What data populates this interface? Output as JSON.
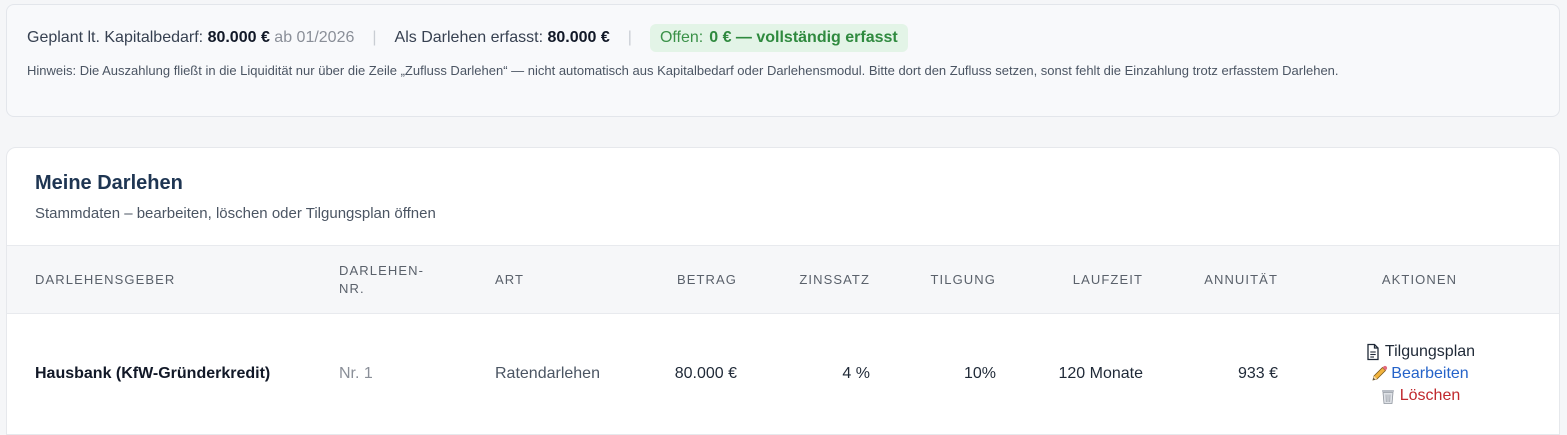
{
  "summary": {
    "planned_label": "Geplant lt. Kapitalbedarf:",
    "planned_value": "80.000 €",
    "planned_since": "ab 01/2026",
    "separator": "|",
    "loans_label": "Als Darlehen erfasst:",
    "loans_value": "80.000 €",
    "open_label": "Offen:",
    "open_value": "0 € — vollständig erfasst",
    "hint": "Hinweis: Die Auszahlung fließt in die Liquidität nur über die Zeile „Zufluss Darlehen“ — nicht automatisch aus Kapitalbedarf oder Darlehensmodul. Bitte dort den Zufluss setzen, sonst fehlt die Einzahlung trotz erfasstem Darlehen."
  },
  "card": {
    "title": "Meine Darlehen",
    "subtitle": "Stammdaten – bearbeiten, löschen oder Tilgungsplan öffnen"
  },
  "table": {
    "headers": {
      "lender": "Darlehensgeber",
      "number_line1": "Darlehen-",
      "number_line2": "Nr.",
      "type": "Art",
      "amount": "Betrag",
      "rate": "Zinssatz",
      "repayment": "Tilgung",
      "term": "Laufzeit",
      "annuity": "Annuität",
      "actions": "Aktionen"
    },
    "rows": [
      {
        "lender": "Hausbank (KfW-Gründerkredit)",
        "number": "Nr. 1",
        "type": "Ratendarlehen",
        "amount": "80.000 €",
        "rate": "4 %",
        "repayment": "10%",
        "term": "120 Monate",
        "annuity": "933 €",
        "action_plan": "Tilgungsplan",
        "action_edit": "Bearbeiten",
        "action_delete": "Löschen"
      }
    ]
  },
  "colors": {
    "title": "#1e3552",
    "ok_bg": "#e3f4e7",
    "ok_text": "#2f8a3f",
    "link_blue": "#2563c9",
    "delete_red": "#c0282d"
  },
  "icons": {
    "plan": "document-icon",
    "edit": "pencil-icon",
    "delete": "trash-icon"
  }
}
